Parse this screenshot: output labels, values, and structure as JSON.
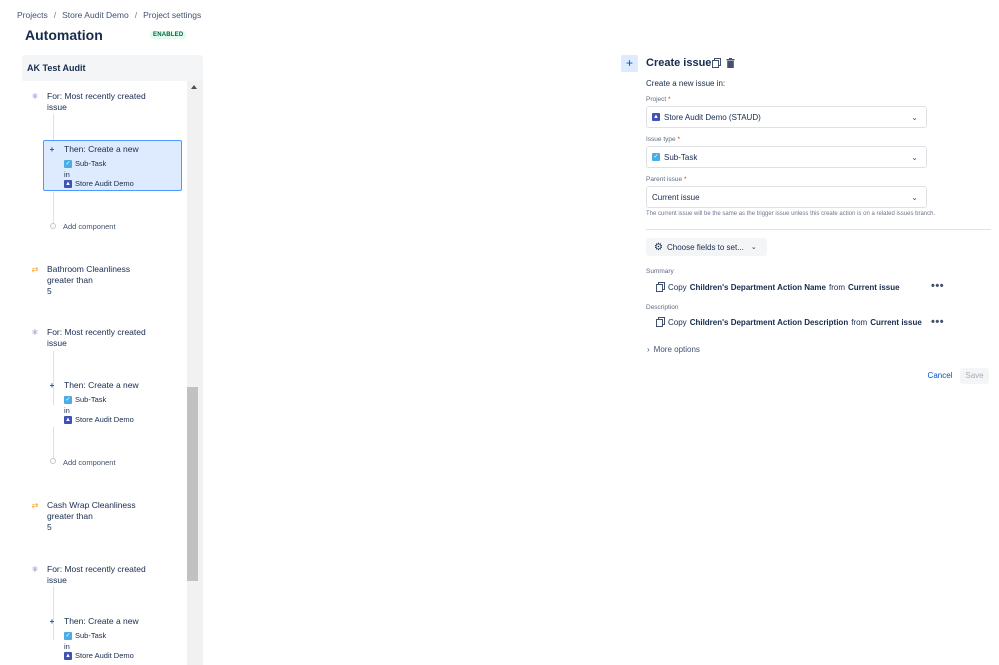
{
  "breadcrumb": {
    "items": [
      "Projects",
      "Store Audit Demo",
      "Project settings"
    ],
    "separator": "/"
  },
  "header": {
    "title": "Automation",
    "status": "ENABLED"
  },
  "rule": {
    "name": "AK Test Audit",
    "nodes": [
      {
        "kind": "branch",
        "line1": "For: Most recently created",
        "line2": "issue"
      },
      {
        "kind": "action",
        "title": "Then: Create a new",
        "issue_type": "Sub-Task",
        "in": "in",
        "project": "Store Audit Demo"
      },
      {
        "kind": "add",
        "label": "Add component"
      },
      {
        "kind": "condition",
        "line1": "Bathroom Cleanliness",
        "line2": "greater than",
        "line3": "5"
      },
      {
        "kind": "branch",
        "line1": "For: Most recently created",
        "line2": "issue"
      },
      {
        "kind": "action",
        "title": "Then: Create a new",
        "issue_type": "Sub-Task",
        "in": "in",
        "project": "Store Audit Demo"
      },
      {
        "kind": "add",
        "label": "Add component"
      },
      {
        "kind": "condition",
        "line1": "Cash Wrap Cleanliness",
        "line2": "greater than",
        "line3": "5"
      },
      {
        "kind": "branch",
        "line1": "For: Most recently created",
        "line2": "issue"
      },
      {
        "kind": "action",
        "title": "Then: Create a new",
        "issue_type": "Sub-Task",
        "in": "in",
        "project": "Store Audit Demo"
      }
    ]
  },
  "editor": {
    "title": "Create issue",
    "subtitle": "Create a new issue in:",
    "project": {
      "label": "Project",
      "value": "Store Audit Demo (STAUD)"
    },
    "issue_type": {
      "label": "Issue type",
      "value": "Sub-Task"
    },
    "parent_issue": {
      "label": "Parent issue",
      "value": "Current issue"
    },
    "required_mark": "*",
    "helper": "The current issue will be the same as the trigger issue unless this create action is on a related issues branch.",
    "choose_fields": "Choose fields to set...",
    "fields": [
      {
        "label": "Summary",
        "prefix": "Copy",
        "field": "Children's Department Action Name",
        "mid": "from",
        "source": "Current issue"
      },
      {
        "label": "Description",
        "prefix": "Copy",
        "field": "Children's Department Action Description",
        "mid": "from",
        "source": "Current issue"
      }
    ],
    "more_options": "More options",
    "cancel": "Cancel",
    "save": "Save"
  },
  "icons": {
    "plus": "plus-icon",
    "copy": "copy-icon",
    "trash": "trash-icon",
    "gear": "gear-icon",
    "chevron": "chevron-down-icon",
    "branch": "branch-icon",
    "condition": "condition-icon"
  },
  "colors": {
    "accent": "#0052cc",
    "selected_bg": "#deebff",
    "selected_border": "#4c9aff",
    "enabled_text": "#006644",
    "enabled_bg": "#e3fcef",
    "branch": "#6554c0",
    "condition": "#ff991f"
  }
}
